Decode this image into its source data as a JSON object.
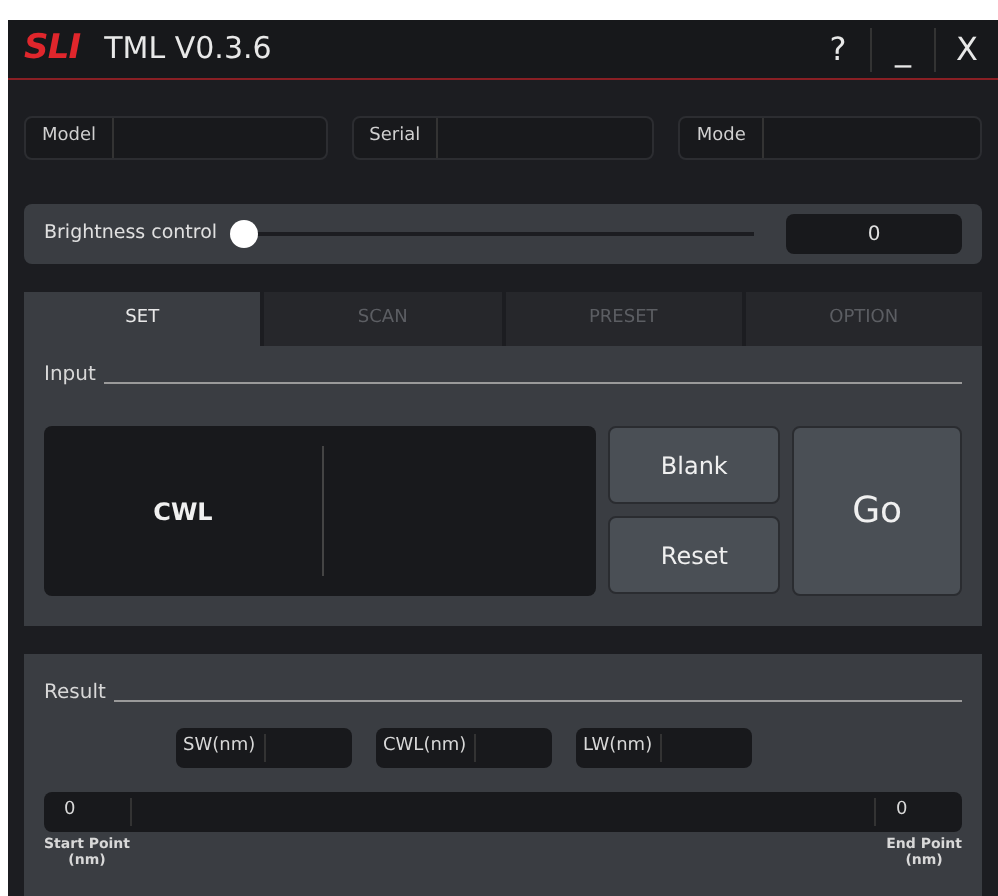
{
  "window": {
    "logo": "SLI",
    "title": "TML V0.3.6",
    "controls": [
      "?",
      "_",
      "X"
    ]
  },
  "info_fields": [
    {
      "label": "Model"
    },
    {
      "label": "Serial"
    },
    {
      "label": "Mode"
    }
  ],
  "brightness": {
    "label": "Brightness control",
    "level": 0,
    "value": "0"
  },
  "tabs": [
    {
      "label": "SET",
      "selected": true
    },
    {
      "label": "SCAN",
      "selected": false
    },
    {
      "label": "PRESET",
      "selected": false
    },
    {
      "label": "OPTION",
      "selected": false
    }
  ],
  "input": {
    "title": "Input",
    "field_label": "CWL",
    "buttons": [
      "Blank",
      "Reset"
    ],
    "go": "Go"
  },
  "result": {
    "title": "Result",
    "fields": [
      {
        "label": "SW(nm)"
      },
      {
        "label": "CWL(nm)"
      },
      {
        "label": "LW(nm)"
      }
    ],
    "start": {
      "value": "0",
      "label": "Start Point",
      "unit": "(nm)"
    },
    "end": {
      "value": "0",
      "label": "End Point",
      "unit": "(nm)"
    }
  }
}
